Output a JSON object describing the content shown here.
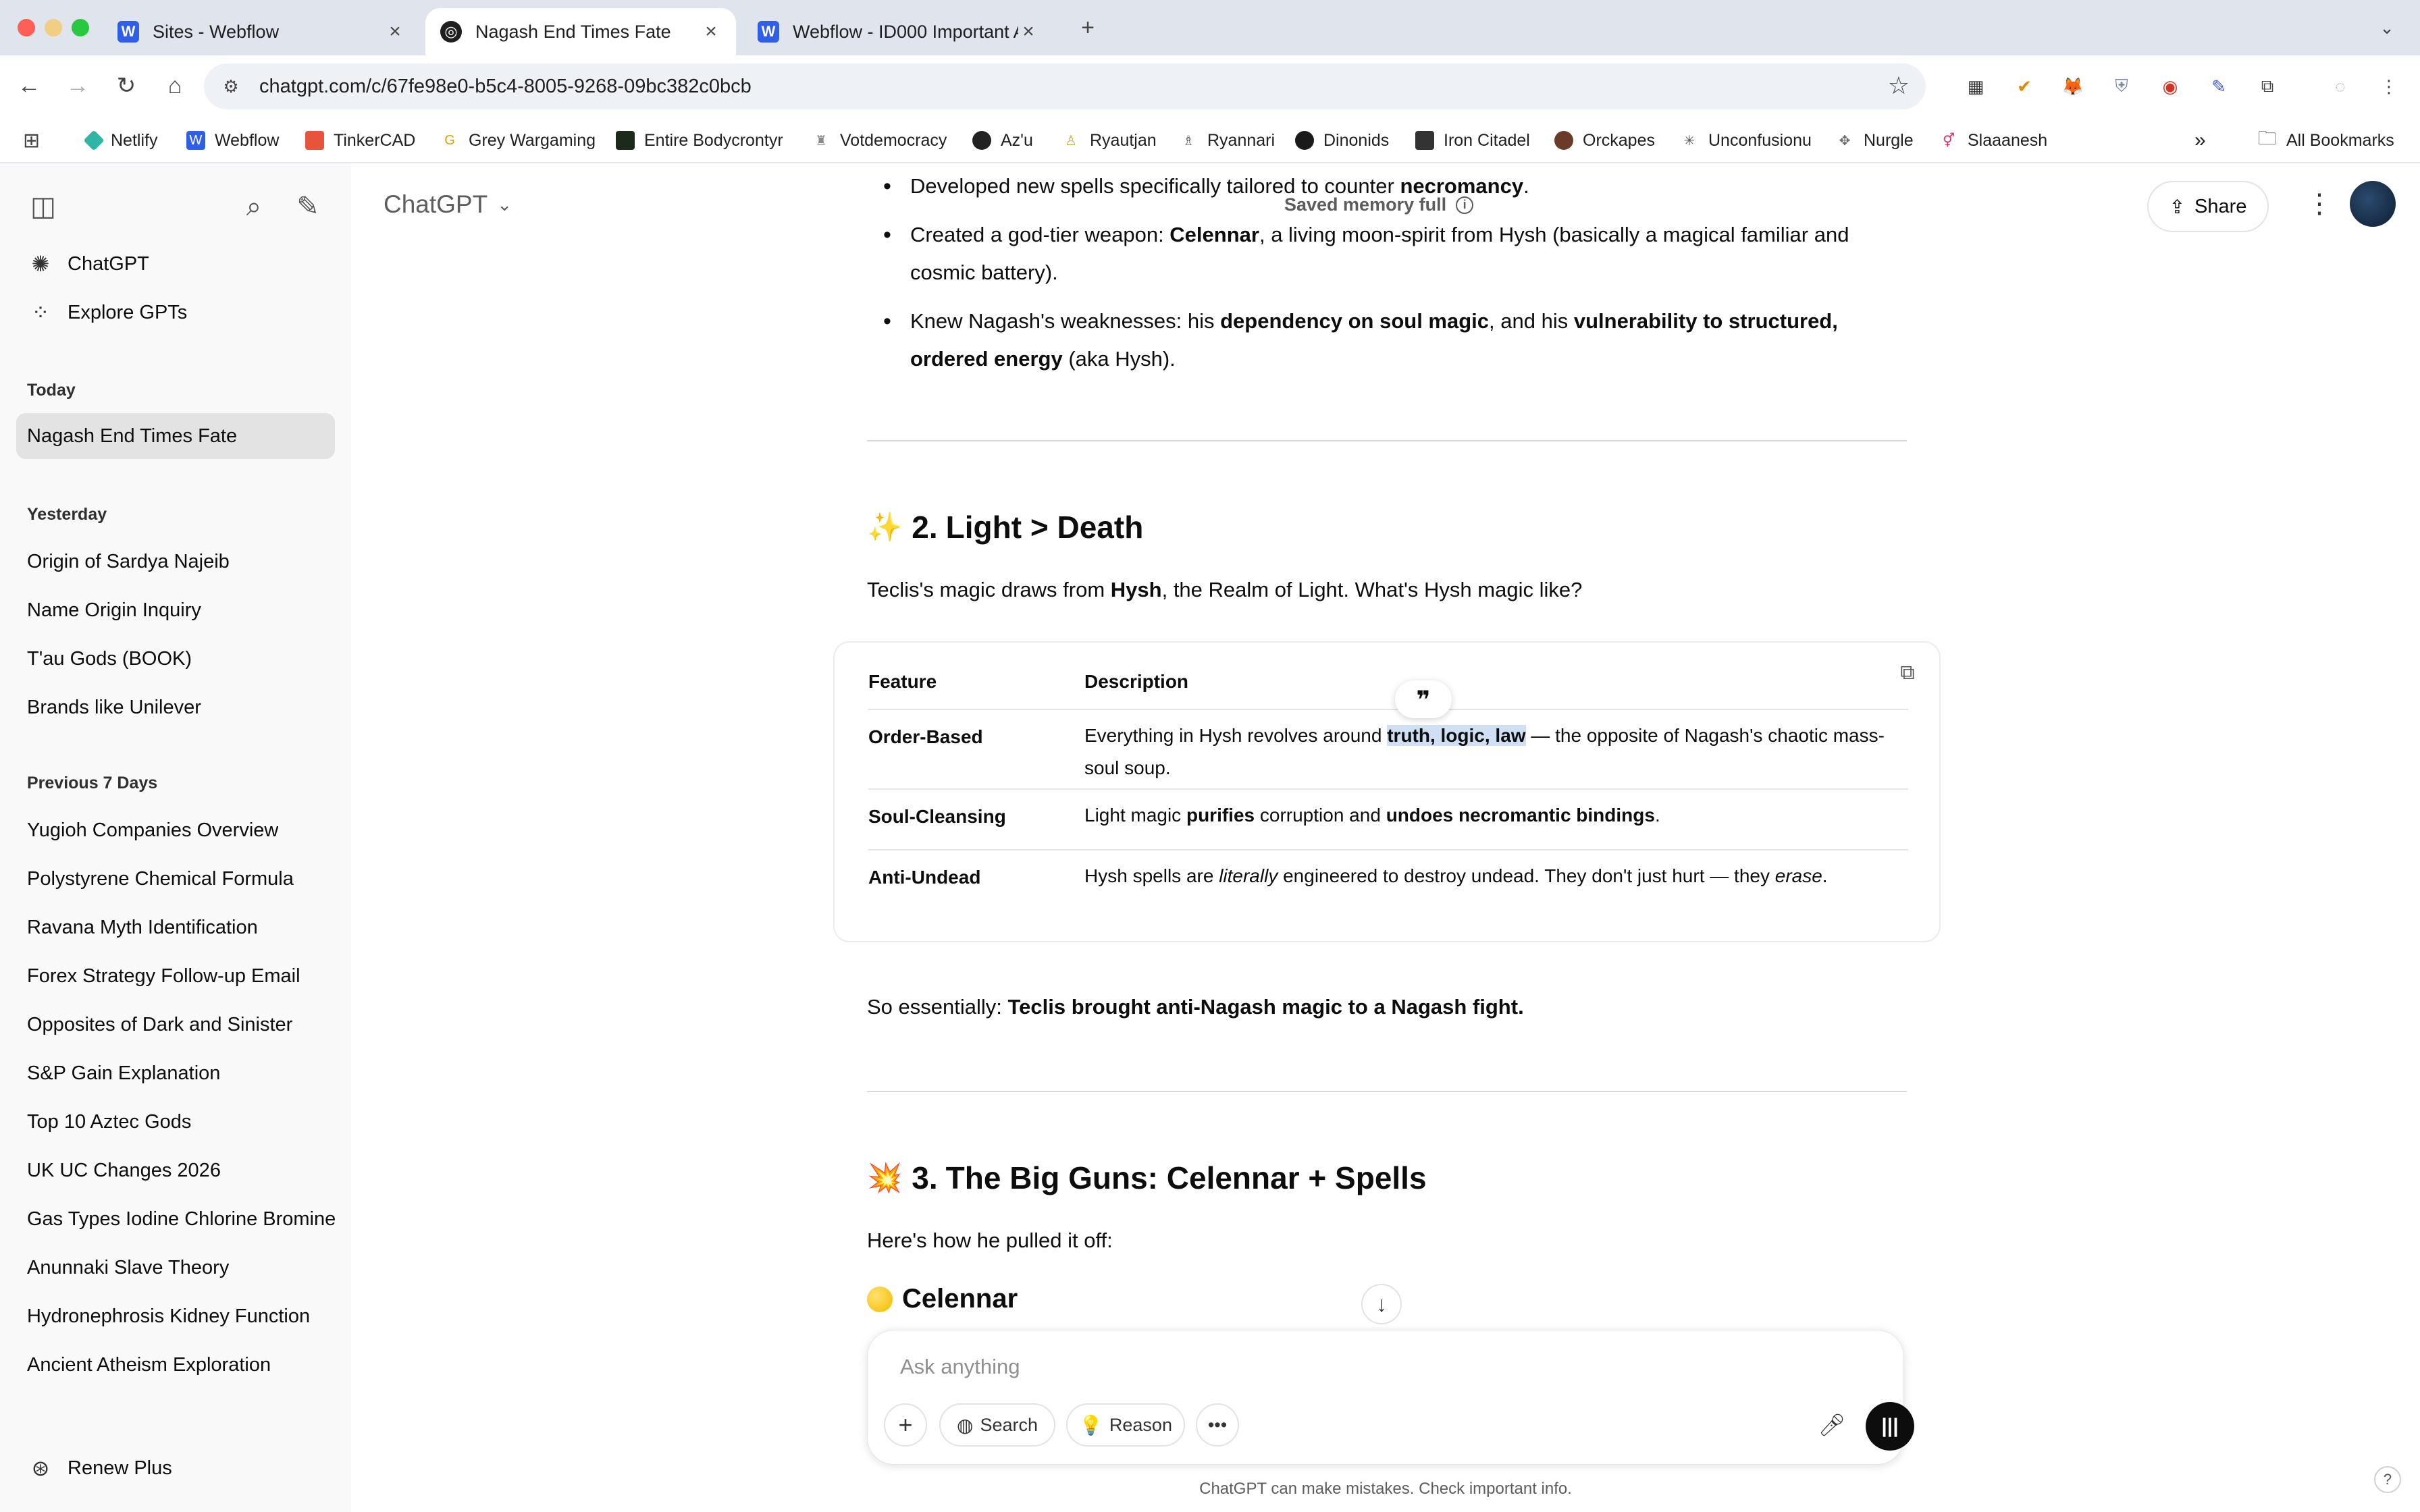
{
  "browser": {
    "tabs": [
      {
        "title": "Sites - Webflow",
        "favicon": "W",
        "favicon_color": "#2f5ee9",
        "active": false
      },
      {
        "title": "Nagash End Times Fate",
        "favicon": "◎",
        "favicon_color": "#1f1f1f",
        "active": true
      },
      {
        "title": "Webflow - ID000 Important A",
        "favicon": "W",
        "favicon_color": "#2f5ee9",
        "active": false
      }
    ],
    "new_tab_icon": "+",
    "tab_search_icon": "chevron-down-icon",
    "url": "chatgpt.com/c/67fe98e0-b5c4-8005-9268-09bc382c0bcb",
    "bookmarks": [
      {
        "label": "Netlify",
        "color": "#2fb5a6"
      },
      {
        "label": "Webflow",
        "color": "#2f5ee9"
      },
      {
        "label": "TinkerCAD",
        "color": "#e8543b"
      },
      {
        "label": "Grey Wargaming",
        "color": "#d9a300"
      },
      {
        "label": "Entire Bodycrontyr",
        "color": "#1b2a1b"
      },
      {
        "label": "Votdemocracy",
        "color": "#8a8a8a"
      },
      {
        "label": "Az'u",
        "color": "#222222"
      },
      {
        "label": "Ryautjan",
        "color": "#c9b14a"
      },
      {
        "label": "Ryannari",
        "color": "#5a5a5a"
      },
      {
        "label": "Dinonids",
        "color": "#1a1a1a"
      },
      {
        "label": "Iron Citadel",
        "color": "#333333"
      },
      {
        "label": "Orckapes",
        "color": "#6b3b2a"
      },
      {
        "label": "Unconfusionu",
        "color": "#555555"
      },
      {
        "label": "Nurgle",
        "color": "#6b6b6b"
      },
      {
        "label": "Slaaanesh",
        "color": "#d6336c"
      }
    ],
    "more_bookmarks": "»",
    "all_bookmarks": "All Bookmarks"
  },
  "sidebar": {
    "nav": [
      {
        "label": "ChatGPT",
        "icon": "chatgpt-logo-icon"
      },
      {
        "label": "Explore GPTs",
        "icon": "grid-icon"
      }
    ],
    "groups": {
      "today": {
        "heading": "Today",
        "items": [
          "Nagash End Times Fate"
        ]
      },
      "yesterday": {
        "heading": "Yesterday",
        "items": [
          "Origin of Sardya Najeib",
          "Name Origin Inquiry",
          "T'au Gods (BOOK)",
          "Brands like Unilever"
        ]
      },
      "previous7": {
        "heading": "Previous 7 Days",
        "items": [
          "Yugioh Companies Overview",
          "Polystyrene Chemical Formula",
          "Ravana Myth Identification",
          "Forex Strategy Follow-up Email",
          "Opposites of Dark and Sinister",
          "S&P Gain Explanation",
          "Top 10 Aztec Gods",
          "UK UC Changes 2026",
          "Gas Types Iodine Chlorine Bromine",
          "Anunnaki Slave Theory",
          "Hydronephrosis Kidney Function",
          "Ancient Atheism Exploration"
        ]
      }
    },
    "renew": "Renew Plus"
  },
  "header": {
    "model": "ChatGPT",
    "memory_note": "Saved memory full",
    "share": "Share"
  },
  "content": {
    "bullets": {
      "b1_pre": "Developed new spells specifically tailored to counter ",
      "b1_bold": "necromancy",
      "b1_post": ".",
      "b2_pre": "Created a god-tier weapon: ",
      "b2_bold": "Celennar",
      "b2_post": ", a living moon-spirit from Hysh (basically a magical familiar and cosmic battery).",
      "b3_pre": "Knew Nagash's weaknesses: his ",
      "b3_bold1": "dependency on soul magic",
      "b3_mid": ", and his ",
      "b3_bold2": "vulnerability to structured, ordered energy",
      "b3_post": " (aka Hysh)."
    },
    "section2": {
      "emoji": "✨",
      "number": "2.",
      "title": "Light > Death",
      "intro_pre": "Teclis's magic draws from ",
      "intro_bold": "Hysh",
      "intro_post": ", the Realm of Light. What's Hysh magic like?"
    },
    "table": {
      "headers": [
        "Feature",
        "Description"
      ],
      "rows": [
        {
          "feature": "Order-Based",
          "d1": "Everything in Hysh revolves around ",
          "d_hl": "truth, logic, law",
          "d2": " — the opposite of Nagash's chaotic mass-soul soup."
        },
        {
          "feature": "Soul-Cleansing",
          "d1": "Light magic ",
          "d_b1": "purifies",
          "d2": " corruption and ",
          "d_b2": "undoes necromantic bindings",
          "d3": "."
        },
        {
          "feature": "Anti-Undead",
          "d1": "Hysh spells are ",
          "d_i1": "literally",
          "d2": " engineered to destroy undead. They don't just hurt — they ",
          "d_i2": "erase",
          "d3": "."
        }
      ]
    },
    "summary_pre": "So essentially: ",
    "summary_bold": "Teclis brought anti-Nagash magic to a Nagash fight.",
    "section3": {
      "emoji": "💥",
      "number": "3.",
      "title": "The Big Guns: Celennar + Spells",
      "intro": "Here's how he pulled it off:",
      "sub": "Celennar"
    }
  },
  "composer": {
    "placeholder": "Ask anything",
    "search": "Search",
    "reason": "Reason"
  },
  "disclaimer": "ChatGPT can make mistakes. Check important info.",
  "help": "?"
}
